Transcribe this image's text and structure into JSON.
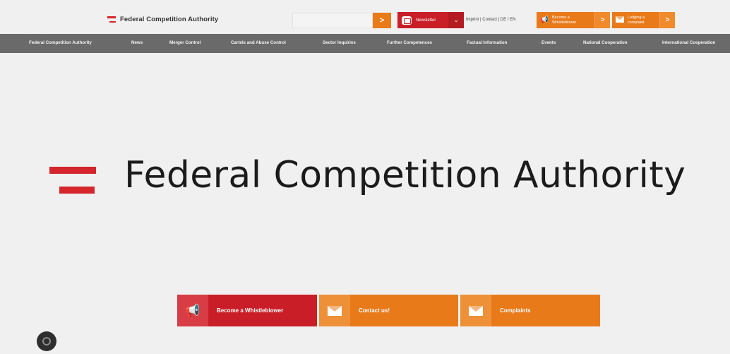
{
  "header": {
    "brand_name": "Federal Competition Authority",
    "search_button": ">",
    "newsletter_label": "Newsletter",
    "newsletter_chevron": "⌄",
    "utility_links": "Imprint | Contact | DE / EN",
    "cta_whistleblower": "Become a Whistleblower",
    "cta_complaint": "Lodging a complaint",
    "cta_arrow": ">"
  },
  "nav": {
    "items": [
      "Federal Competition Authority",
      "News",
      "Merger Control",
      "Cartels and Abuse Control",
      "Sector Inquiries",
      "Further Competences",
      "Factual Information",
      "Events",
      "National Cooperation",
      "International Cooperation"
    ]
  },
  "hero": {
    "title": "Federal Competition Authority"
  },
  "tiles": {
    "whistleblower": "Become a Whistleblower",
    "contact": "Contact us!",
    "complaints": "Complaints"
  },
  "icons": {
    "megaphone": "megaphone-icon",
    "envelope": "envelope-icon",
    "accessibility": "accessibility-icon"
  },
  "colors": {
    "brand_red": "#c91e27",
    "brand_orange": "#e97a1a",
    "nav_gray": "#6a6a6a",
    "background": "#f0f0f0"
  }
}
